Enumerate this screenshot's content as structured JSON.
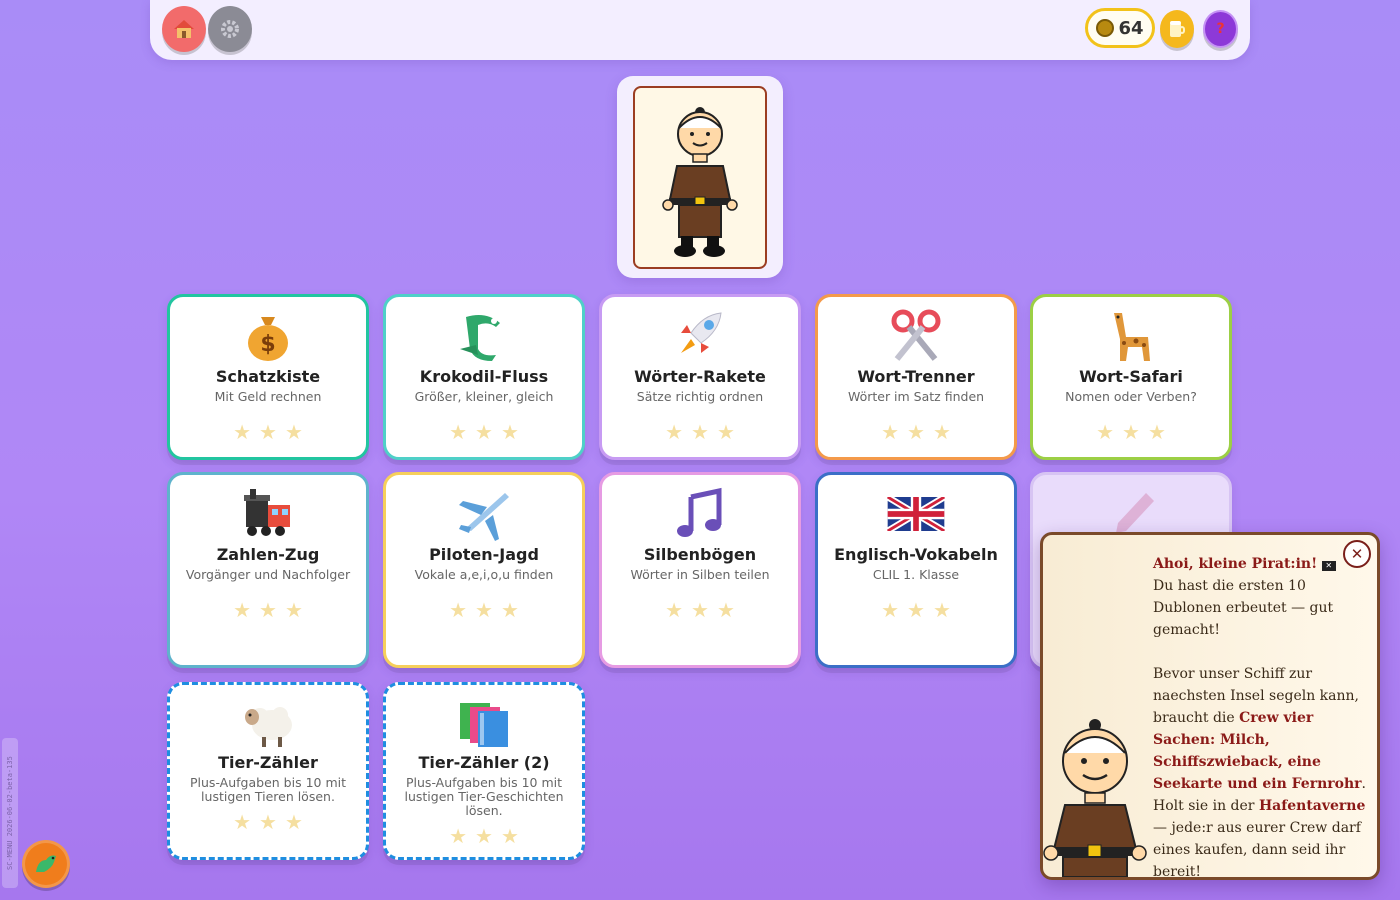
{
  "topbar": {
    "coins": "64",
    "help_label": "?"
  },
  "cards": [
    {
      "title": "Schatzkiste",
      "sub": "Mit Geld rechnen",
      "color": "#22c5a0",
      "icon": "money-bag-icon"
    },
    {
      "title": "Krokodil-Fluss",
      "sub": "Größer, kleiner, gleich",
      "color": "#4fd0c8",
      "icon": "crocodile-icon"
    },
    {
      "title": "Wörter-Rakete",
      "sub": "Sätze richtig ordnen",
      "color": "#c79bf3",
      "icon": "rocket-icon"
    },
    {
      "title": "Wort-Trenner",
      "sub": "Wörter im Satz finden",
      "color": "#f49a4a",
      "icon": "scissors-icon"
    },
    {
      "title": "Wort-Safari",
      "sub": "Nomen oder Verben?",
      "color": "#9ccf45",
      "icon": "giraffe-icon"
    },
    {
      "title": "Zahlen-Zug",
      "sub": "Vorgänger und Nachfolger",
      "color": "#5fb3cc",
      "icon": "train-icon"
    },
    {
      "title": "Piloten-Jagd",
      "sub": "Vokale a,e,i,o,u finden",
      "color": "#f6cf5b",
      "icon": "airplane-icon"
    },
    {
      "title": "Silbenbögen",
      "sub": "Wörter in Silben teilen",
      "color": "#e69be3",
      "icon": "music-note-icon"
    },
    {
      "title": "Englisch-Vokabeln",
      "sub": "CLIL 1. Klasse",
      "color": "#3b6fc7",
      "icon": "uk-flag-icon"
    },
    {
      "title": "Tier-Zähler",
      "sub": "Plus-Aufgaben bis 10 mit lustigen Tieren lösen.",
      "color": "#1f8ee0",
      "icon": "sheep-icon"
    },
    {
      "title": "Tier-Zähler (2)",
      "sub": "Plus-Aufgaben bis 10 mit lustigen Tier-Geschichten lösen.",
      "color": "#1f8ee0",
      "icon": "books-icon"
    }
  ],
  "dialog": {
    "greeting": "Ahoi, kleine Pirat:in!",
    "line1": "Du hast die ersten 10 Dublonen erbeutet — gut gemacht!",
    "p2_a": "Bevor unser Schiff zur naechsten Insel segeln kann, braucht die ",
    "p2_hl": "Crew vier Sachen: Milch, Schiffszwieback, eine Seekarte und ein Fernrohr",
    "p2_b": ". Holt sie in der ",
    "p2_hl2": "Hafentaverne",
    "p2_c": " — jede:r aus eurer Crew darf eines kaufen, dann seid ihr bereit!",
    "close": "✕"
  },
  "version": "SC-MENU 2026-06-02-beta-135"
}
